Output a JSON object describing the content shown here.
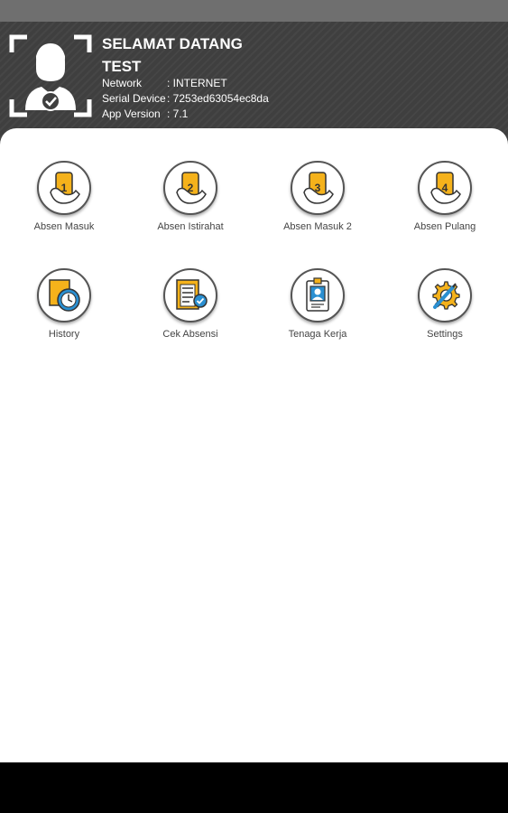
{
  "header": {
    "welcome_line1": "SELAMAT DATANG",
    "welcome_line2": "TEST",
    "network_label": "Network",
    "network_value": ": INTERNET",
    "serial_label": "Serial Device",
    "serial_value": ": 7253ed63054ec8da",
    "version_label": "App Version",
    "version_value": ": 7.1"
  },
  "menu": [
    {
      "label": "Absen Masuk",
      "icon": "phone-hand-1-icon"
    },
    {
      "label": "Absen Istirahat",
      "icon": "phone-hand-2-icon"
    },
    {
      "label": "Absen Masuk 2",
      "icon": "phone-hand-3-icon"
    },
    {
      "label": "Absen Pulang",
      "icon": "phone-hand-4-icon"
    },
    {
      "label": "History",
      "icon": "clock-history-icon"
    },
    {
      "label": "Cek Absensi",
      "icon": "checklist-icon"
    },
    {
      "label": "Tenaga Kerja",
      "icon": "id-badge-icon"
    },
    {
      "label": "Settings",
      "icon": "gear-wrench-icon"
    }
  ],
  "colors": {
    "header_bg": "#3f3f3f",
    "accent_orange": "#f5b21b",
    "accent_blue": "#2a8fd1",
    "nav_bar": "#000000"
  }
}
